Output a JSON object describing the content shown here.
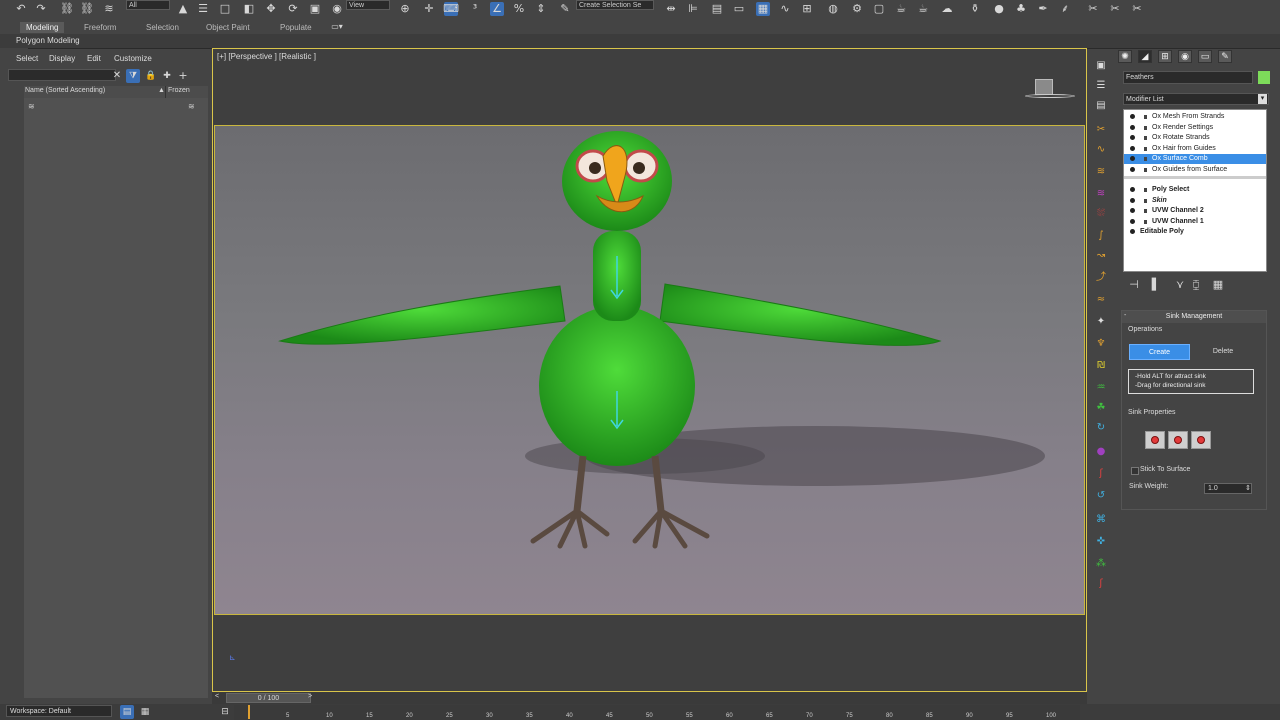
{
  "toolbar": {
    "selection_filter": "All",
    "ref_coord": "View",
    "named_selection_placeholder": "Create Selection Se"
  },
  "ribbon": {
    "tabs": [
      "Modeling",
      "Freeform",
      "Selection",
      "Object Paint",
      "Populate"
    ],
    "active_tab": "Modeling",
    "sub_label": "Polygon Modeling"
  },
  "scene_explorer": {
    "menu": [
      "Select",
      "Display",
      "Edit",
      "Customize"
    ],
    "column_name": "Name (Sorted Ascending)",
    "column_frozen": "Frozen"
  },
  "viewport": {
    "label": "[+] [Perspective ] [Realistic ]"
  },
  "command_panel": {
    "object_name": "Feathers",
    "object_color": "#7ddc5a",
    "modifier_list_label": "Modifier List",
    "modifier_stack": [
      {
        "label": "Ox Mesh From Strands",
        "style": "normal",
        "selected": false
      },
      {
        "label": "Ox Render Settings",
        "style": "normal",
        "selected": false
      },
      {
        "label": "Ox Rotate Strands",
        "style": "normal",
        "selected": false
      },
      {
        "label": "Ox Hair from Guides",
        "style": "normal",
        "selected": false
      },
      {
        "label": "Ox Surface Comb",
        "style": "normal",
        "selected": true
      },
      {
        "label": "Ox Guides from Surface",
        "style": "normal",
        "selected": false
      },
      {
        "label": "Poly Select",
        "style": "bold",
        "selected": false
      },
      {
        "label": "Skin",
        "style": "italic",
        "selected": false
      },
      {
        "label": "UVW Channel 2",
        "style": "bold",
        "selected": false
      },
      {
        "label": "UVW Channel 1",
        "style": "bold",
        "selected": false
      },
      {
        "label": "Editable Poly",
        "style": "base",
        "selected": false
      }
    ],
    "sink_management": {
      "title": "Sink Management",
      "operations_label": "Operations",
      "create_label": "Create",
      "delete_label": "Delete",
      "hint_line1": "-Hold ALT for attract sink",
      "hint_line2": "-Drag for directional sink",
      "properties_label": "Sink Properties",
      "stick_to_surface_label": "Stick To Surface",
      "sink_weight_label": "Sink Weight:",
      "sink_weight_value": "1.0"
    }
  },
  "status": {
    "workspace": "Workspace: Default",
    "time_position": "0 / 100",
    "track_ticks": [
      "5",
      "10",
      "15",
      "20",
      "25",
      "30",
      "35",
      "40",
      "45",
      "50",
      "55",
      "60",
      "65",
      "70",
      "75",
      "80",
      "85",
      "90",
      "95",
      "100"
    ]
  },
  "colors": {
    "accent": "#3a8ee6",
    "viewport_border": "#d9c54a",
    "feather_green": "#2fbf2a"
  }
}
